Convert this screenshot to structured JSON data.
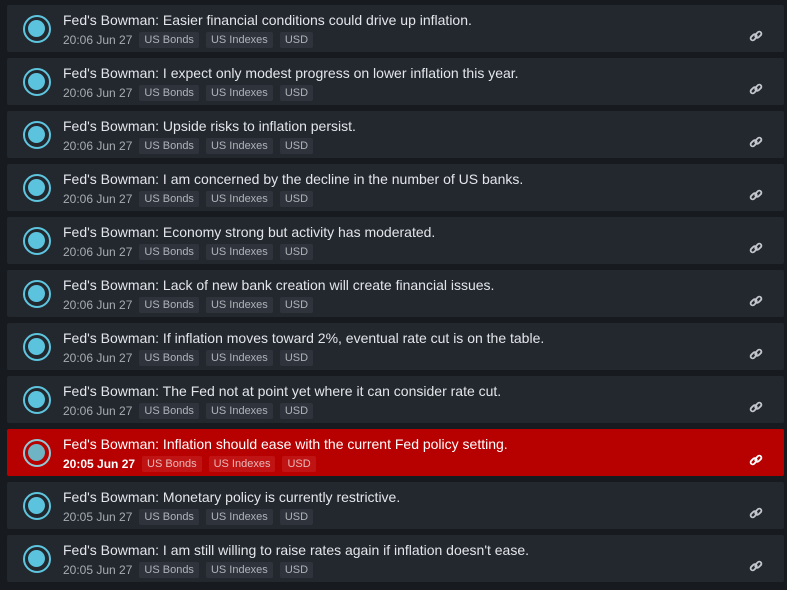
{
  "feed": {
    "items": [
      {
        "headline": "Fed's Bowman: Easier financial conditions could drive up inflation.",
        "time": "20:06 Jun 27",
        "tags": [
          "US Bonds",
          "US Indexes",
          "USD"
        ],
        "highlighted": false
      },
      {
        "headline": "Fed's Bowman: I expect only modest progress on lower inflation this year.",
        "time": "20:06 Jun 27",
        "tags": [
          "US Bonds",
          "US Indexes",
          "USD"
        ],
        "highlighted": false
      },
      {
        "headline": "Fed's Bowman: Upside risks to inflation persist.",
        "time": "20:06 Jun 27",
        "tags": [
          "US Bonds",
          "US Indexes",
          "USD"
        ],
        "highlighted": false
      },
      {
        "headline": "Fed's Bowman: I am concerned by the decline in the number of US banks.",
        "time": "20:06 Jun 27",
        "tags": [
          "US Bonds",
          "US Indexes",
          "USD"
        ],
        "highlighted": false
      },
      {
        "headline": "Fed's Bowman: Economy strong but activity has moderated.",
        "time": "20:06 Jun 27",
        "tags": [
          "US Bonds",
          "US Indexes",
          "USD"
        ],
        "highlighted": false
      },
      {
        "headline": "Fed's Bowman: Lack of new bank creation will create financial issues.",
        "time": "20:06 Jun 27",
        "tags": [
          "US Bonds",
          "US Indexes",
          "USD"
        ],
        "highlighted": false
      },
      {
        "headline": "Fed's Bowman: If inflation moves toward 2%, eventual rate cut is on the table.",
        "time": "20:06 Jun 27",
        "tags": [
          "US Bonds",
          "US Indexes",
          "USD"
        ],
        "highlighted": false
      },
      {
        "headline": "Fed's Bowman: The Fed not at point yet where it can consider rate cut.",
        "time": "20:06 Jun 27",
        "tags": [
          "US Bonds",
          "US Indexes",
          "USD"
        ],
        "highlighted": false
      },
      {
        "headline": "Fed's Bowman: Inflation should ease with the current Fed policy setting.",
        "time": "20:05 Jun 27",
        "tags": [
          "US Bonds",
          "US Indexes",
          "USD"
        ],
        "highlighted": true
      },
      {
        "headline": "Fed's Bowman: Monetary policy is currently restrictive.",
        "time": "20:05 Jun 27",
        "tags": [
          "US Bonds",
          "US Indexes",
          "USD"
        ],
        "highlighted": false
      },
      {
        "headline": "Fed's Bowman: I am still willing to raise rates again if inflation doesn't ease.",
        "time": "20:05 Jun 27",
        "tags": [
          "US Bonds",
          "US Indexes",
          "USD"
        ],
        "highlighted": false
      }
    ]
  },
  "icons": {
    "status": "circle-status-icon",
    "link": "link-icon"
  },
  "colors": {
    "background": "#171a1f",
    "row": "#23272e",
    "highlight": "#b70000",
    "accent": "#5bc3de"
  }
}
